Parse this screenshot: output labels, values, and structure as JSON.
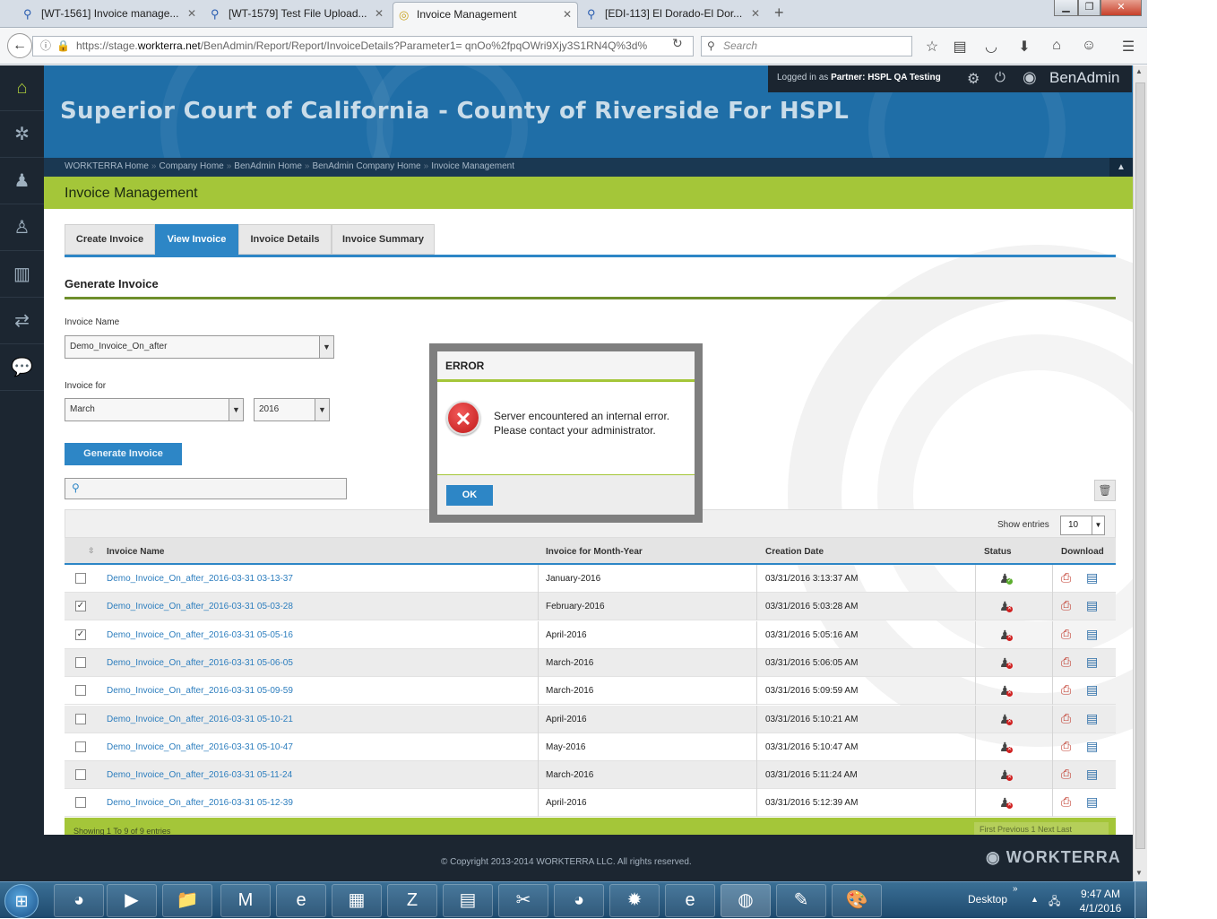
{
  "browser": {
    "tabs": [
      {
        "title": "[WT-1561] Invoice manage...",
        "active": false
      },
      {
        "title": "[WT-1579] Test File Upload...",
        "active": false
      },
      {
        "title": "Invoice Management",
        "active": true
      },
      {
        "title": "[EDI-113] El Dorado-El Dor...",
        "active": false
      }
    ],
    "url_prefix": "https://stage.",
    "url_domain": "workterra.net",
    "url_rest": "/BenAdmin/Report/Report/InvoiceDetails?Parameter1= qnOo%2fpqOWri9Xjy3S1RN4Q%3d%",
    "search_placeholder": "Search"
  },
  "header": {
    "company": "Superior Court of California - County of Riverside For HSPL",
    "logged_in_prefix": "Logged in as",
    "logged_in_role": "Partner:",
    "logged_in_user": "HSPL QA Testing",
    "brand": "BenAdmin"
  },
  "breadcrumb": [
    "WORKTERRA Home",
    "Company Home",
    "BenAdmin Home",
    "BenAdmin Company Home",
    "Invoice Management"
  ],
  "page_title": "Invoice Management",
  "tabs": [
    "Create Invoice",
    "View Invoice",
    "Invoice Details",
    "Invoice Summary"
  ],
  "selected_tab": "View Invoice",
  "form": {
    "section_title": "Generate Invoice",
    "invoice_name_label": "Invoice Name",
    "invoice_name_value": "Demo_Invoice_On_after",
    "invoice_for_label": "Invoice for",
    "month_value": "March",
    "year_value": "2016",
    "generate_button": "Generate Invoice"
  },
  "table": {
    "show_entries_label": "Show entries",
    "show_entries_value": "10",
    "columns": [
      "Invoice Name",
      "Invoice for Month-Year",
      "Creation Date",
      "Status",
      "Download"
    ],
    "rows": [
      {
        "name": "Demo_Invoice_On_after_2016-03-31 03-13-37",
        "period": "January-2016",
        "created": "03/31/2016 3:13:37 AM",
        "checked": false,
        "status": "ok"
      },
      {
        "name": "Demo_Invoice_On_after_2016-03-31 05-03-28",
        "period": "February-2016",
        "created": "03/31/2016 5:03:28 AM",
        "checked": true,
        "status": "error"
      },
      {
        "name": "Demo_Invoice_On_after_2016-03-31 05-05-16",
        "period": "April-2016",
        "created": "03/31/2016 5:05:16 AM",
        "checked": true,
        "status": "error"
      },
      {
        "name": "Demo_Invoice_On_after_2016-03-31 05-06-05",
        "period": "March-2016",
        "created": "03/31/2016 5:06:05 AM",
        "checked": false,
        "status": "error"
      },
      {
        "name": "Demo_Invoice_On_after_2016-03-31 05-09-59",
        "period": "March-2016",
        "created": "03/31/2016 5:09:59 AM",
        "checked": false,
        "status": "error"
      },
      {
        "name": "Demo_Invoice_On_after_2016-03-31 05-10-21",
        "period": "April-2016",
        "created": "03/31/2016 5:10:21 AM",
        "checked": false,
        "status": "error"
      },
      {
        "name": "Demo_Invoice_On_after_2016-03-31 05-10-47",
        "period": "May-2016",
        "created": "03/31/2016 5:10:47 AM",
        "checked": false,
        "status": "error"
      },
      {
        "name": "Demo_Invoice_On_after_2016-03-31 05-11-24",
        "period": "March-2016",
        "created": "03/31/2016 5:11:24 AM",
        "checked": false,
        "status": "error"
      },
      {
        "name": "Demo_Invoice_On_after_2016-03-31 05-12-39",
        "period": "April-2016",
        "created": "03/31/2016 5:12:39 AM",
        "checked": false,
        "status": "error"
      }
    ],
    "footer_info": "Showing 1 To 9 of 9 entries",
    "pager": "First  Previous  1  Next  Last"
  },
  "modal": {
    "title": "ERROR",
    "message": "Server encountered an internal error. Please contact your administrator.",
    "ok_label": "OK"
  },
  "footer": {
    "copyright": "© Copyright 2013-2014 WORKTERRA LLC. All rights reserved.",
    "logo": "WORKTERRA"
  },
  "taskbar": {
    "desktop_label": "Desktop",
    "time": "9:47 AM",
    "date": "4/1/2016"
  },
  "colors": {
    "header_blue": "#1f6ea7",
    "accent_green": "#a4c639",
    "tab_blue": "#2d86c6",
    "error_red": "#d02020"
  }
}
